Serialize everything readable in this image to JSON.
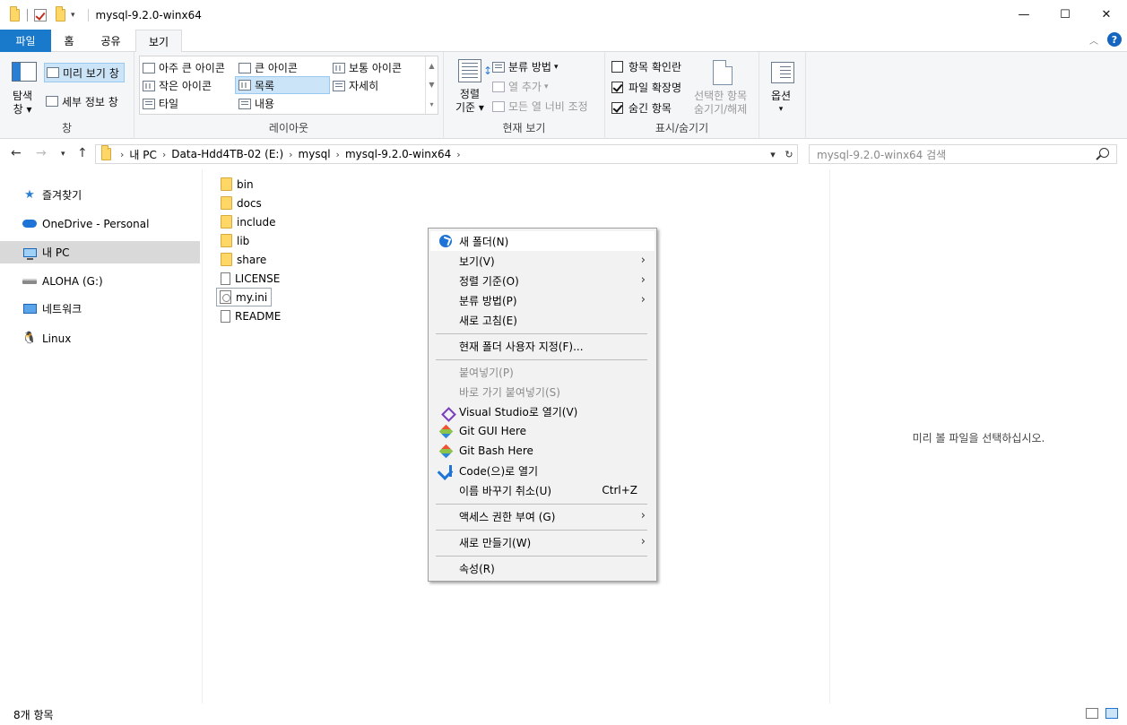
{
  "window": {
    "title": "mysql-9.2.0-winx64",
    "minimize": "—",
    "maximize": "☐",
    "close": "✕"
  },
  "ribbon_tabs": {
    "file": "파일",
    "home": "홈",
    "share": "공유",
    "view": "보기",
    "help": "?"
  },
  "ribbon": {
    "pane_group": {
      "nav_pane_label_1": "탐색",
      "nav_pane_label_2": "창",
      "preview_pane": "미리 보기 창",
      "details_pane": "세부 정보 창",
      "group_label": "창"
    },
    "layout_group": {
      "items": [
        "아주 큰 아이콘",
        "큰 아이콘",
        "보통 아이콘",
        "작은 아이콘",
        "목록",
        "자세히",
        "타일",
        "내용"
      ],
      "selected": "목록",
      "group_label": "레이아웃"
    },
    "current_view_group": {
      "sort_by_1": "정렬",
      "sort_by_2": "기준",
      "group_by": "분류 방법",
      "add_column": "열 추가",
      "fit_columns": "모든 열 너비 조정",
      "group_label": "현재 보기"
    },
    "show_hide_group": {
      "item_checkboxes": {
        "label": "항목 확인란",
        "checked": false
      },
      "file_extensions": {
        "label": "파일 확장명",
        "checked": true
      },
      "hidden_items": {
        "label": "숨긴 항목",
        "checked": true
      },
      "hide_selected_1": "선택한 항목",
      "hide_selected_2": "숨기기/해제",
      "group_label": "표시/숨기기"
    },
    "options_group": {
      "label": "옵션"
    }
  },
  "address": {
    "breadcrumbs": [
      "내 PC",
      "Data-Hdd4TB-02 (E:)",
      "mysql",
      "mysql-9.2.0-winx64"
    ],
    "search_placeholder": "mysql-9.2.0-winx64 검색"
  },
  "nav_pane": {
    "items": [
      {
        "label": "즐겨찾기",
        "icon": "star-icon"
      },
      {
        "label": "OneDrive - Personal",
        "icon": "cloud-icon"
      },
      {
        "label": "내 PC",
        "icon": "computer-icon",
        "selected": true
      },
      {
        "label": "ALOHA (G:)",
        "icon": "drive-icon"
      },
      {
        "label": "네트워크",
        "icon": "network-icon"
      },
      {
        "label": "Linux",
        "icon": "linux-icon"
      }
    ]
  },
  "files": [
    {
      "name": "bin",
      "type": "folder"
    },
    {
      "name": "docs",
      "type": "folder"
    },
    {
      "name": "include",
      "type": "folder"
    },
    {
      "name": "lib",
      "type": "folder"
    },
    {
      "name": "share",
      "type": "folder"
    },
    {
      "name": "LICENSE",
      "type": "file"
    },
    {
      "name": "my.ini",
      "type": "ini"
    },
    {
      "name": "README",
      "type": "file"
    }
  ],
  "preview": {
    "empty_text": "미리 볼 파일을 선택하십시오."
  },
  "status": {
    "item_count": "8개 항목"
  },
  "context_menu": {
    "items": [
      {
        "label": "새 폴더(N)",
        "icon": "new-folder-icon"
      },
      {
        "label": "보기(V)",
        "submenu": true
      },
      {
        "label": "정렬 기준(O)",
        "submenu": true
      },
      {
        "label": "분류 방법(P)",
        "submenu": true
      },
      {
        "label": "새로 고침(E)"
      },
      {
        "label": "현재 폴더 사용자 지정(F)..."
      },
      {
        "label": "붙여넣기(P)",
        "disabled": true
      },
      {
        "label": "바로 가기 붙여넣기(S)",
        "disabled": true
      },
      {
        "label": "Visual Studio로 열기(V)",
        "icon": "visual-studio-icon"
      },
      {
        "label": "Git GUI Here",
        "icon": "git-icon"
      },
      {
        "label": "Git Bash Here",
        "icon": "git-icon"
      },
      {
        "label": "Code(으)로 열기",
        "icon": "vscode-icon"
      },
      {
        "label": "이름 바꾸기 취소(U)",
        "shortcut": "Ctrl+Z"
      },
      {
        "label": "액세스 권한 부여 (G)",
        "submenu": true
      },
      {
        "label": "새로 만들기(W)",
        "submenu": true
      },
      {
        "label": "속성(R)"
      }
    ]
  },
  "colors": {
    "accent": "#1979ca",
    "selection": "#cce4f7",
    "nav_selected": "#d9d9d9",
    "menu_bg": "#f2f2f2"
  }
}
